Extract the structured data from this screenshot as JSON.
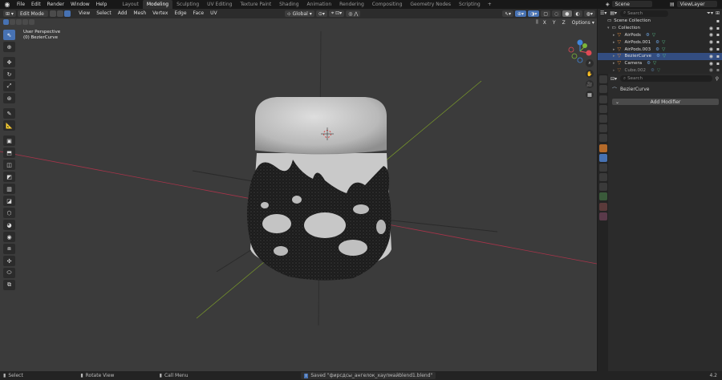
{
  "topbar": {
    "menus": [
      "File",
      "Edit",
      "Render",
      "Window",
      "Help"
    ],
    "workspaces": [
      "Layout",
      "Modeling",
      "Sculpting",
      "UV Editing",
      "Texture Paint",
      "Shading",
      "Animation",
      "Rendering",
      "Compositing",
      "Geometry Nodes",
      "Scripting"
    ],
    "active_workspace": "Modeling",
    "scene_name": "Scene",
    "view_layer": "ViewLayer"
  },
  "viewport_header": {
    "mode": "Edit Mode",
    "menus": [
      "View",
      "Select",
      "Add",
      "Mesh",
      "Vertex",
      "Edge",
      "Face",
      "UV"
    ],
    "transform_orientation": "Global",
    "options_label": "Options",
    "axis_x": "X",
    "axis_y": "Y",
    "axis_z": "Z"
  },
  "viewport_overlay": {
    "perspective": "User Perspective",
    "object_name": "(0) BezierCurve"
  },
  "outliner": {
    "root": "Scene Collection",
    "collection": "Collection",
    "items": [
      {
        "name": "AirPods",
        "icon": "triangle-mesh-icon",
        "selected": false
      },
      {
        "name": "AirPods.001",
        "icon": "triangle-mesh-icon",
        "selected": false
      },
      {
        "name": "AirPods.003",
        "icon": "triangle-mesh-icon",
        "selected": false
      },
      {
        "name": "BezierCurve",
        "icon": "curve-icon",
        "selected": true
      },
      {
        "name": "Camera",
        "icon": "camera-icon",
        "selected": false
      },
      {
        "name": "Cube.002",
        "icon": "triangle-mesh-icon",
        "selected": false
      }
    ],
    "search_placeholder": "Search"
  },
  "properties": {
    "search_placeholder": "Search",
    "object_name": "BezierCurve",
    "add_modifier_label": "Add Modifier"
  },
  "statusbar": {
    "select": "Select",
    "rotate": "Rotate View",
    "call_menu": "Call Menu",
    "saved_message": "Saved \"фирсдсы_ангелок_хаупмайblend1.blend\"",
    "version": "4.2"
  },
  "colors": {
    "accent": "#4772b3",
    "viewport_bg": "#3b3b3b",
    "x_axis": "#a8344a",
    "y_axis": "#7a9a2a",
    "selected_row": "#334d80",
    "gizmo_x": "#e14a55",
    "gizmo_y": "#7cb639",
    "gizmo_z": "#3f86db"
  }
}
